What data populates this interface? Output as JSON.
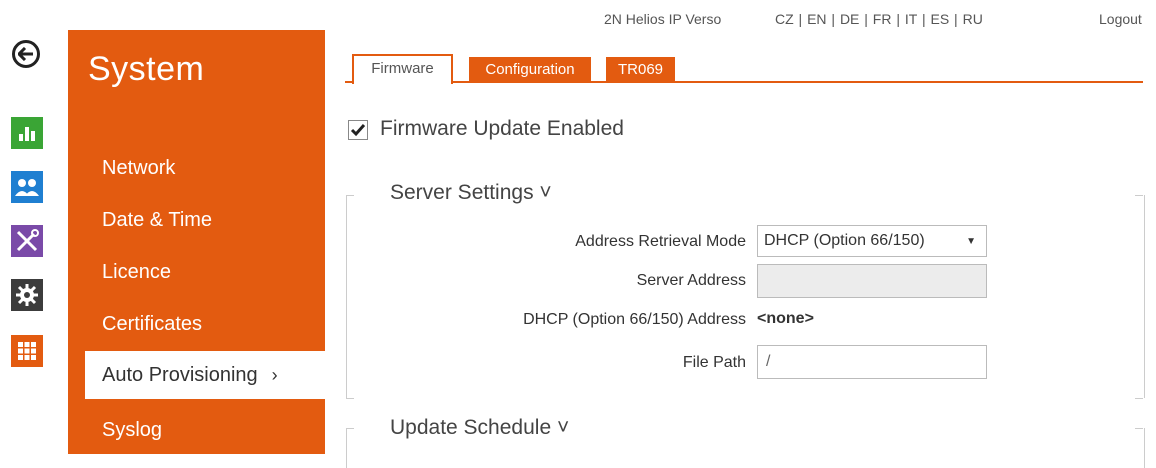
{
  "topbar": {
    "device_name": "2N Helios IP Verso",
    "languages": "CZ | EN | DE | FR | IT | ES | RU",
    "logout": "Logout"
  },
  "rail": {
    "icons": [
      "back-arrow-icon",
      "statistics-icon",
      "users-icon",
      "tools-icon",
      "gear-icon",
      "grid-icon"
    ],
    "colors": {
      "statistics": "#3aa535",
      "users": "#1f7fd1",
      "tools": "#7a4aa8",
      "gear": "#3c3c3c",
      "grid": "#e35b10"
    }
  },
  "sidebar": {
    "title": "System",
    "items": [
      {
        "label": "Network"
      },
      {
        "label": "Date & Time"
      },
      {
        "label": "Licence"
      },
      {
        "label": "Certificates"
      },
      {
        "label": "Auto Provisioning",
        "chevron": "›"
      },
      {
        "label": "Syslog"
      }
    ],
    "accent_color": "#e35b10"
  },
  "tabs": [
    {
      "label": "Firmware"
    },
    {
      "label": "Configuration"
    },
    {
      "label": "TR069"
    }
  ],
  "firmware": {
    "update_enabled_label": "Firmware Update Enabled",
    "server_settings_title": "Server Settings ˅",
    "address_mode_label": "Address Retrieval Mode",
    "address_mode_value": "DHCP (Option 66/150)",
    "server_address_label": "Server Address",
    "server_address_value": "",
    "dhcp_address_label": "DHCP (Option 66/150) Address",
    "dhcp_address_value": "<none>",
    "file_path_label": "File Path",
    "file_path_value": "/",
    "update_schedule_title": "Update Schedule ˅"
  }
}
